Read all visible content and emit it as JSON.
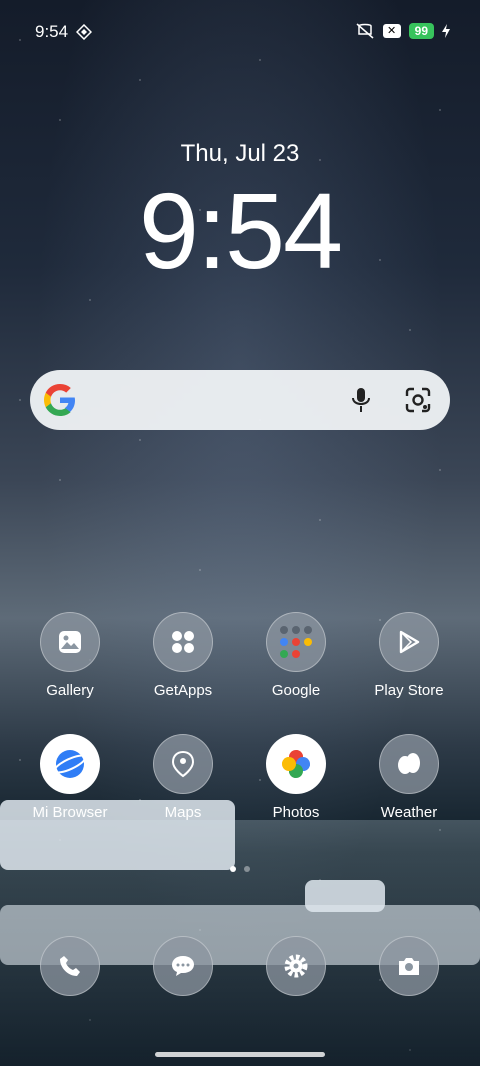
{
  "status": {
    "time": "9:54",
    "battery": "99",
    "x_icon": "x-box-icon",
    "mute_icon": "vibrate-off-icon"
  },
  "lockscreen": {
    "date": "Thu, Jul 23",
    "clock": "9:54"
  },
  "search": {
    "google_icon": "google-logo-icon",
    "mic_icon": "mic-icon",
    "lens_icon": "lens-icon"
  },
  "apps_row1": [
    {
      "label": "Gallery",
      "icon": "gallery-icon"
    },
    {
      "label": "GetApps",
      "icon": "getapps-icon"
    },
    {
      "label": "Google",
      "icon": "google-folder-icon"
    },
    {
      "label": "Play Store",
      "icon": "play-store-icon"
    }
  ],
  "apps_row2": [
    {
      "label": "Mi Browser",
      "icon": "browser-icon"
    },
    {
      "label": "Maps",
      "icon": "maps-icon"
    },
    {
      "label": "Photos",
      "icon": "photos-icon"
    },
    {
      "label": "Weather",
      "icon": "weather-icon"
    }
  ],
  "dock": [
    {
      "icon": "phone-icon"
    },
    {
      "icon": "messages-icon"
    },
    {
      "icon": "settings-icon"
    },
    {
      "icon": "camera-icon"
    }
  ]
}
